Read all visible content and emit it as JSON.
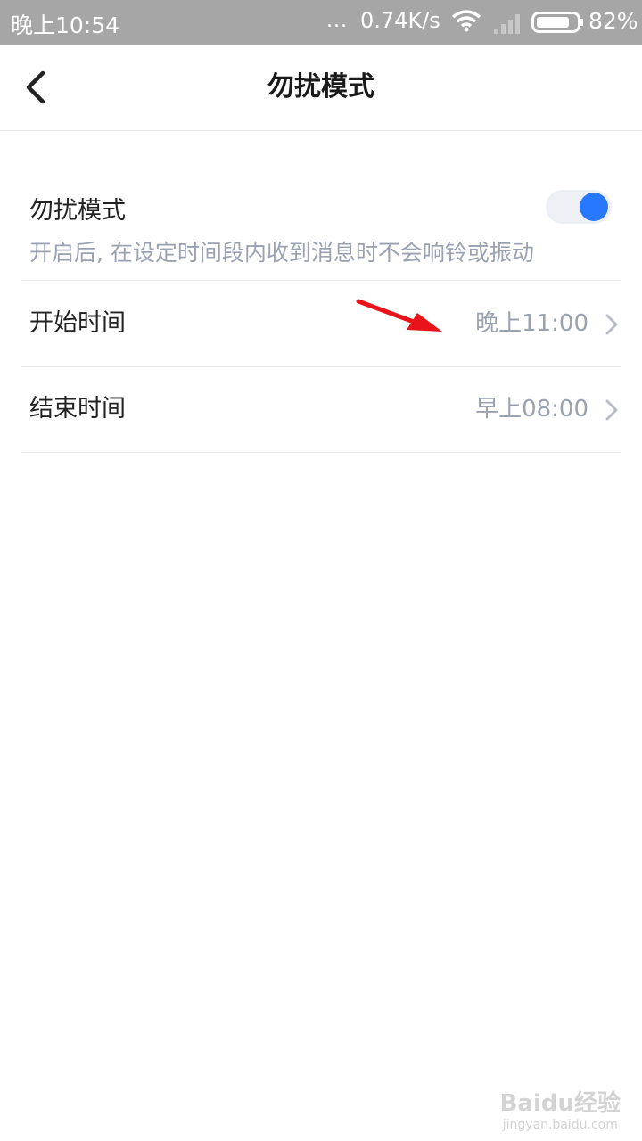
{
  "status_bar": {
    "time": "晚上10:54",
    "dots": "...",
    "net_speed": "0.74K/s",
    "battery": "82%"
  },
  "nav": {
    "title": "勿扰模式"
  },
  "settings": {
    "dnd": {
      "label": "勿扰模式",
      "description": "开启后, 在设定时间段内收到消息时不会响铃或振动",
      "enabled": true
    },
    "start_time": {
      "label": "开始时间",
      "value": "晚上11:00"
    },
    "end_time": {
      "label": "结束时间",
      "value": "早上08:00"
    }
  },
  "watermark": {
    "text": "Baidu经验",
    "url": "jingyan.baidu.com"
  },
  "colors": {
    "accent": "#2878ff",
    "status_bar": "#a6a6a6",
    "annotation_arrow": "#e8141a"
  }
}
